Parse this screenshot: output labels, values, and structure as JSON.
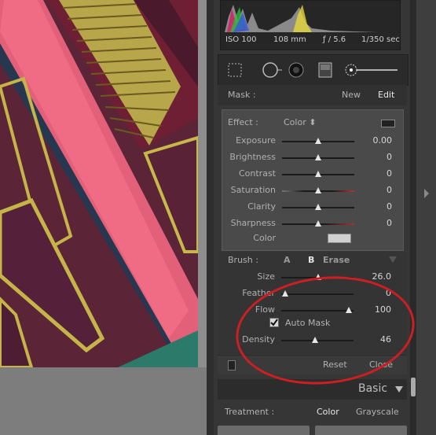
{
  "exif": {
    "iso": "ISO 100",
    "focal": "108 mm",
    "aperture": "ƒ / 5.6",
    "shutter": "1/350 sec"
  },
  "mask": {
    "label": "Mask :",
    "new": "New",
    "edit": "Edit"
  },
  "effect": {
    "label": "Effect :",
    "preset": "Color ⬍",
    "sliders": [
      {
        "label": "Exposure",
        "value": "0.00"
      },
      {
        "label": "Brightness",
        "value": "0"
      },
      {
        "label": "Contrast",
        "value": "0"
      },
      {
        "label": "Saturation",
        "value": "0"
      },
      {
        "label": "Clarity",
        "value": "0"
      },
      {
        "label": "Sharpness",
        "value": "0"
      }
    ],
    "color_label": "Color"
  },
  "brush": {
    "label": "Brush :",
    "a": "A",
    "b": "B",
    "erase": "Erase",
    "size_label": "Size",
    "size_value": "26.0",
    "feather_label": "Feather",
    "feather_value": "0",
    "flow_label": "Flow",
    "flow_value": "100",
    "automask_label": "Auto Mask",
    "density_label": "Density",
    "density_value": "46"
  },
  "footer": {
    "reset": "Reset",
    "close": "Close"
  },
  "basic": {
    "label": "Basic"
  },
  "treatment": {
    "label": "Treatment :",
    "color": "Color",
    "grayscale": "Grayscale"
  },
  "colors": {
    "highlight_oval": "#cc1f24",
    "mask_overlay": "#ff3a6a"
  }
}
